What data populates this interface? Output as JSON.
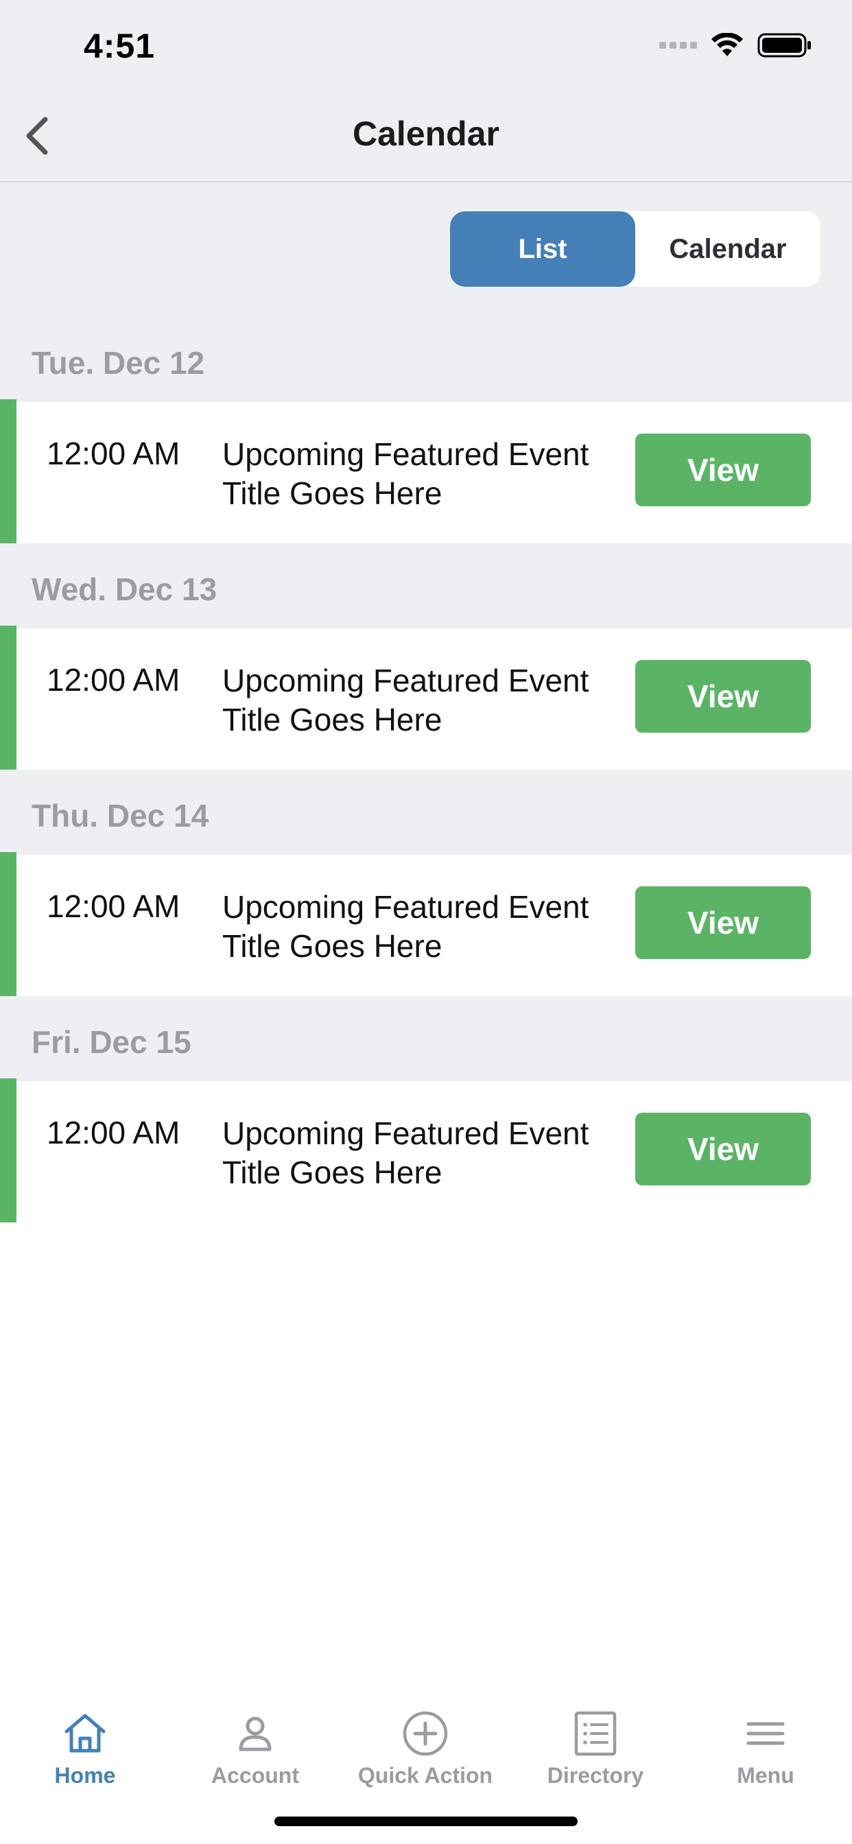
{
  "status_bar": {
    "time": "4:51"
  },
  "nav": {
    "title": "Calendar"
  },
  "segmented": {
    "list_label": "List",
    "calendar_label": "Calendar",
    "selected": "List"
  },
  "days": [
    {
      "label": "Tue. Dec 12",
      "time": "12:00 AM",
      "title": "Upcoming Featured Event Title Goes Here",
      "button": "View"
    },
    {
      "label": "Wed. Dec 13",
      "time": "12:00 AM",
      "title": "Upcoming Featured Event Title Goes Here",
      "button": "View"
    },
    {
      "label": "Thu. Dec 14",
      "time": "12:00 AM",
      "title": "Upcoming Featured Event Title Goes Here",
      "button": "View"
    },
    {
      "label": "Fri. Dec 15",
      "time": "12:00 AM",
      "title": "Upcoming Featured Event Title Goes Here",
      "button": "View"
    }
  ],
  "tabbar": {
    "items": [
      {
        "label": "Home",
        "icon": "home-icon",
        "active": true
      },
      {
        "label": "Account",
        "icon": "person-icon",
        "active": false
      },
      {
        "label": "Quick Action",
        "icon": "plus-circle-icon",
        "active": false
      },
      {
        "label": "Directory",
        "icon": "list-document-icon",
        "active": false
      },
      {
        "label": "Menu",
        "icon": "hamburger-menu-icon",
        "active": false
      }
    ]
  },
  "colors": {
    "accent": "#4480b7",
    "event_green": "#5bb466",
    "background_gray": "#eeeff3",
    "muted_text": "#9a9ca4"
  }
}
